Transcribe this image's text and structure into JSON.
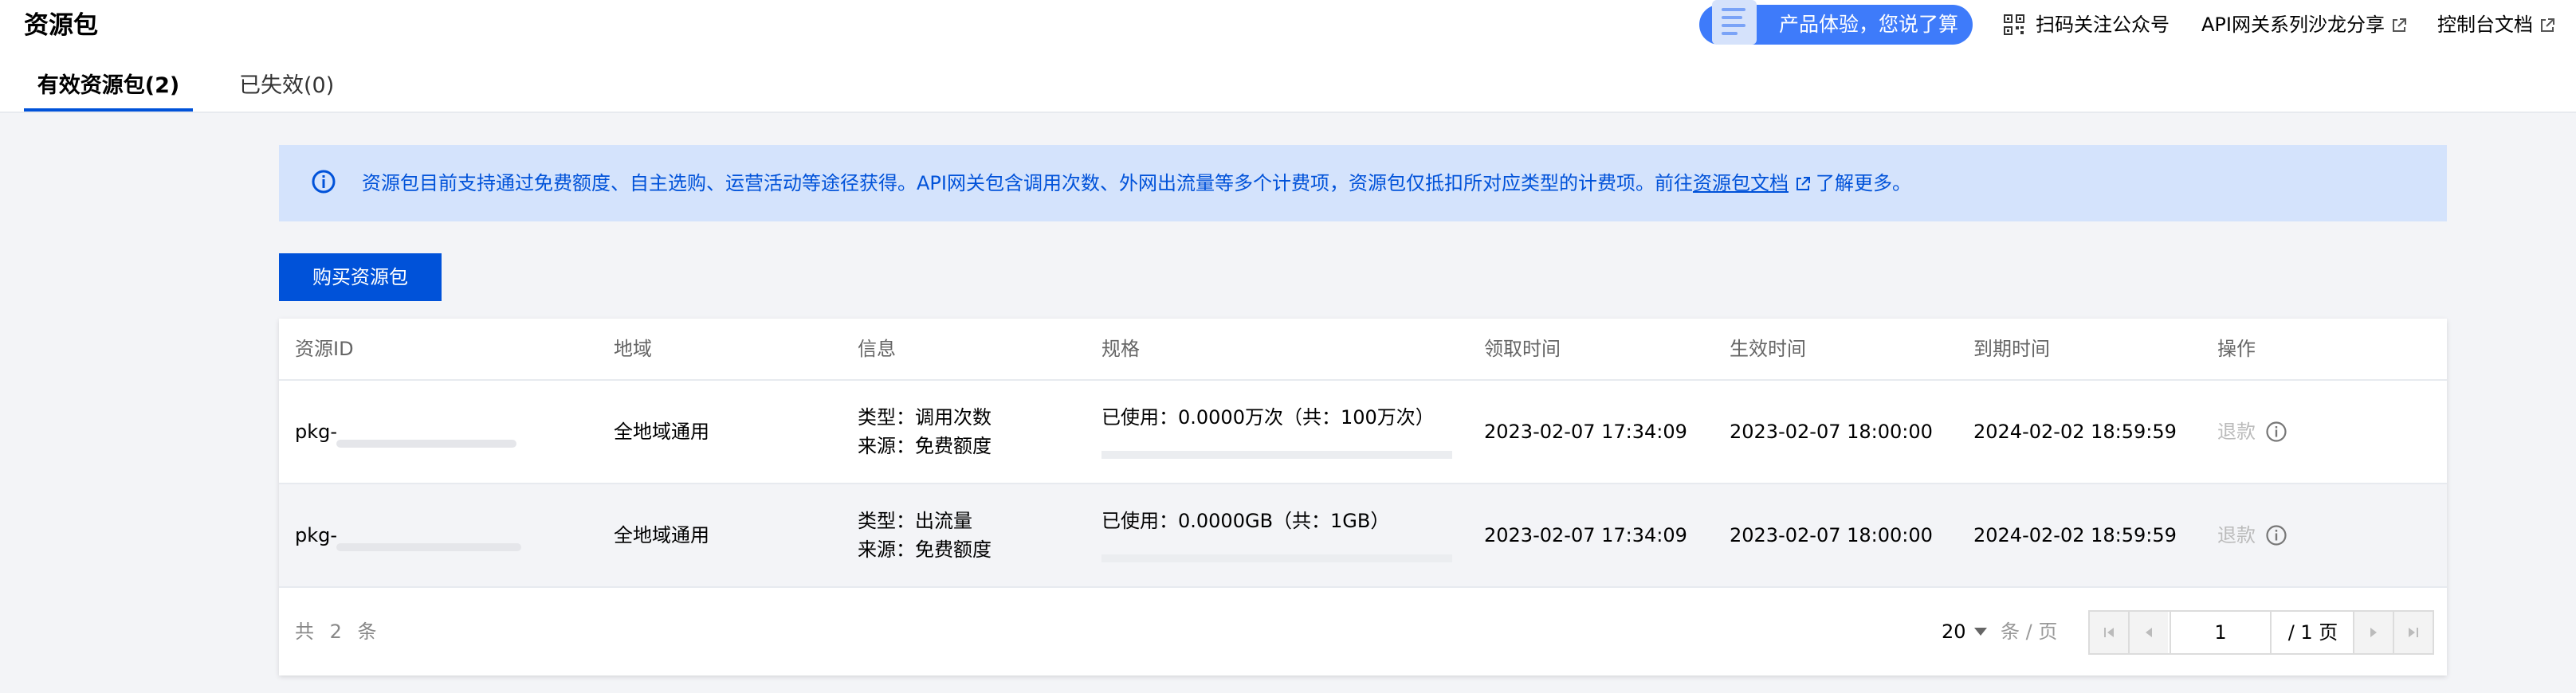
{
  "header": {
    "title": "资源包",
    "tabs": [
      {
        "label": "有效资源包(2)",
        "active": true
      },
      {
        "label": "已失效(0)",
        "active": false
      }
    ],
    "feedback_button": "产品体验，您说了算",
    "links": {
      "qr": "扫码关注公众号",
      "salon": "API网关系列沙龙分享",
      "docs": "控制台文档"
    }
  },
  "notice": {
    "text": "资源包目前支持通过免费额度、自主选购、运营活动等途径获得。API网关包含调用次数、外网出流量等多个计费项，资源包仅抵扣所对应类型的计费项。前往",
    "link": "资源包文档",
    "suffix": "了解更多。"
  },
  "buy_button": "购买资源包",
  "table": {
    "headers": [
      "资源ID",
      "地域",
      "信息",
      "规格",
      "领取时间",
      "生效时间",
      "到期时间",
      "操作"
    ],
    "rows": [
      {
        "id": "pkg-",
        "region": "全地域通用",
        "type": "类型：调用次数",
        "source": "来源：免费额度",
        "spec": "已使用：0.0000万次（共：100万次）",
        "usage_fraction": 0,
        "received": "2023-02-07 17:34:09",
        "effective": "2023-02-07 18:00:00",
        "expires": "2024-02-02 18:59:59",
        "action": "退款"
      },
      {
        "id": "pkg-",
        "region": "全地域通用",
        "type": "类型：出流量",
        "source": "来源：免费额度",
        "spec": "已使用：0.0000GB（共：1GB）",
        "usage_fraction": 0,
        "received": "2023-02-07 17:34:09",
        "effective": "2023-02-07 18:00:00",
        "expires": "2024-02-02 18:59:59",
        "action": "退款"
      }
    ],
    "footer": {
      "total": "共 2 条",
      "page_size": "20",
      "per_page": "条 / 页",
      "current_page": "1",
      "total_pages": "/ 1 页"
    }
  },
  "colors": {
    "primary": "#0052d9",
    "notice_bg": "#d4e3fc",
    "feedback_bg": "#3e7bfa",
    "disabled_text": "#bbbbbb"
  },
  "icons": [
    "doc-illustration-icon",
    "qrcode-icon",
    "external-link-icon",
    "info-icon",
    "first-page-icon",
    "prev-page-icon",
    "next-page-icon",
    "last-page-icon"
  ]
}
